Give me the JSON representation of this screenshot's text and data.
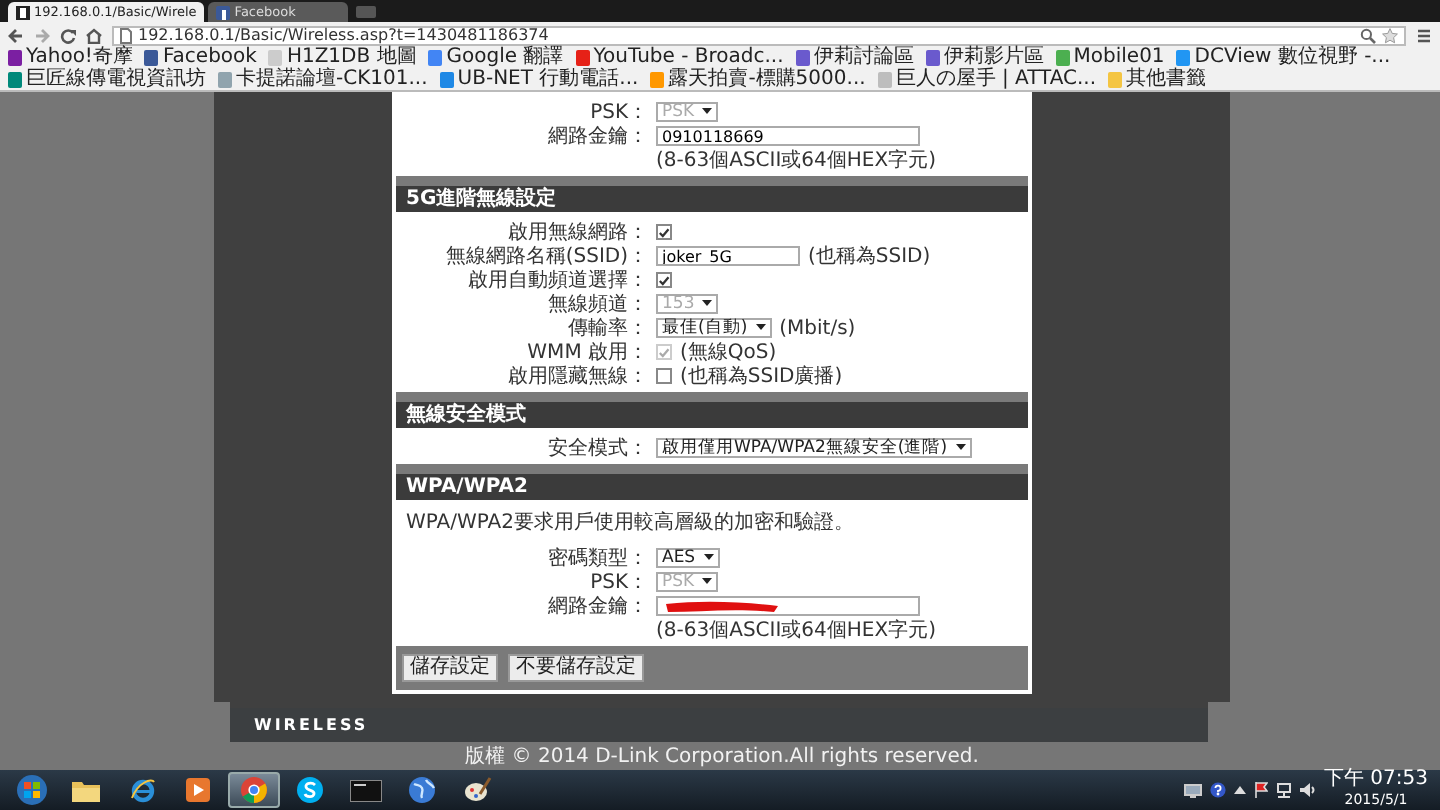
{
  "browser": {
    "tabs": [
      {
        "title": "192.168.0.1/Basic/Wirele",
        "selected": true,
        "kind": "router"
      },
      {
        "title": "Facebook",
        "selected": false,
        "kind": "facebook"
      }
    ],
    "address": "192.168.0.1/Basic/Wireless.asp?t=1430481186374",
    "bookmarks": [
      {
        "label": "Yahoo!奇摩",
        "color": "#7b1fa2"
      },
      {
        "label": "Facebook",
        "color": "#3b5998"
      },
      {
        "label": "H1Z1DB 地圖",
        "color": "#cccccc"
      },
      {
        "label": "Google 翻譯",
        "color": "#4285f4"
      },
      {
        "label": "YouTube - Broadc...",
        "color": "#e62117"
      },
      {
        "label": "伊莉討論區",
        "color": "#6a5acd"
      },
      {
        "label": "伊莉影片區",
        "color": "#6a5acd"
      },
      {
        "label": "Mobile01",
        "color": "#4caf50"
      },
      {
        "label": "DCView 數位視野 -...",
        "color": "#2196f3"
      },
      {
        "label": "巨匠線傳電視資訊坊",
        "color": "#00897b"
      },
      {
        "label": "卡提諾論壇-CK101...",
        "color": "#90a4ae"
      },
      {
        "label": "UB-NET 行動電話...",
        "color": "#1e88e5"
      },
      {
        "label": "露天拍賣-標購5000...",
        "color": "#ff9800"
      },
      {
        "label": "巨人の屋手 | ATTAC...",
        "color": "#bdbdbd"
      },
      {
        "label": "其他書籤",
        "color": "#f4c542"
      }
    ]
  },
  "page": {
    "sections": [
      {
        "rows": [
          {
            "kind": "select",
            "label": "PSK：",
            "value": "PSK",
            "disabled": true
          },
          {
            "kind": "input",
            "label": "網路金鑰：",
            "value": "0910118669"
          },
          {
            "kind": "hint",
            "text": "(8-63個ASCII或64個HEX字元)"
          }
        ]
      },
      {
        "title": "5G進階無線設定",
        "rows": [
          {
            "kind": "checkbox",
            "label": "啟用無線網路：",
            "checked": true,
            "disabled": false
          },
          {
            "kind": "input",
            "label": "無線網路名稱(SSID)：",
            "value": "joker_5G",
            "note": "(也稱為SSID)"
          },
          {
            "kind": "checkbox",
            "label": "啟用自動頻道選擇：",
            "checked": true,
            "disabled": false
          },
          {
            "kind": "select",
            "label": "無線頻道：",
            "value": "153",
            "disabled": true
          },
          {
            "kind": "select",
            "label": "傳輸率：",
            "value": "最佳(自動)",
            "disabled": false,
            "note": "(Mbit/s)"
          },
          {
            "kind": "checkbox",
            "label": "WMM 啟用：",
            "checked": true,
            "disabled": true,
            "note": "(無線QoS)"
          },
          {
            "kind": "checkbox",
            "label": "啟用隱藏無線：",
            "checked": false,
            "disabled": false,
            "note": "(也稱為SSID廣播)"
          }
        ]
      },
      {
        "title": "無線安全模式",
        "rows": [
          {
            "kind": "select",
            "label": "安全模式：",
            "value": "啟用僅用WPA/WPA2無線安全(進階)",
            "disabled": false
          }
        ]
      },
      {
        "title": "WPA/WPA2",
        "description": "WPA/WPA2要求用戶使用較高層級的加密和驗證。",
        "rows": [
          {
            "kind": "select",
            "label": "密碼類型：",
            "value": "AES",
            "disabled": false
          },
          {
            "kind": "select",
            "label": "PSK：",
            "value": "PSK",
            "disabled": true
          },
          {
            "kind": "input",
            "label": "網路金鑰：",
            "redacted": true
          },
          {
            "kind": "hint",
            "text": "(8-63個ASCII或64個HEX字元)"
          }
        ]
      }
    ],
    "buttons": [
      "儲存設定",
      "不要儲存設定"
    ],
    "brand": "WIRELESS",
    "copyright": "版權 © 2014 D-Link Corporation.All rights reserved."
  },
  "taskbar": {
    "apps": [
      {
        "kind": "start",
        "selected": false
      },
      {
        "kind": "folder",
        "selected": false
      },
      {
        "kind": "ie",
        "selected": false
      },
      {
        "kind": "media",
        "selected": false
      },
      {
        "kind": "chrome",
        "selected": true
      },
      {
        "kind": "skype",
        "selected": false
      },
      {
        "kind": "terminal",
        "selected": false
      },
      {
        "kind": "globe",
        "selected": false
      },
      {
        "kind": "paint",
        "selected": false
      }
    ],
    "time": "下午 07:53",
    "date": "2015/5/1"
  }
}
